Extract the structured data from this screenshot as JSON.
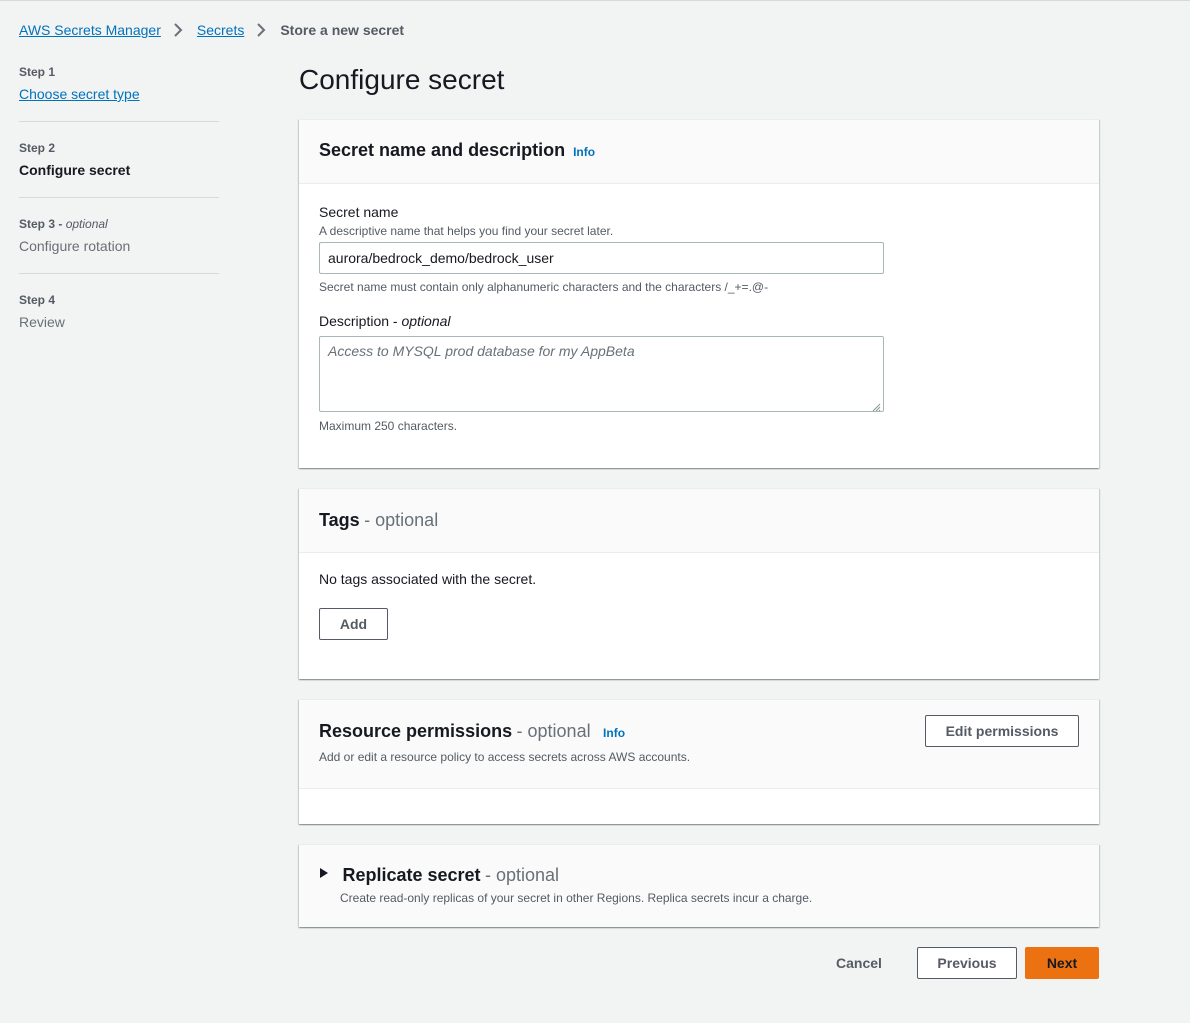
{
  "breadcrumb": {
    "items": [
      "AWS Secrets Manager",
      "Secrets"
    ],
    "current": "Store a new secret"
  },
  "steps": [
    {
      "label": "Step 1",
      "optional": "",
      "title": "Choose secret type",
      "state": "link"
    },
    {
      "label": "Step 2",
      "optional": "",
      "title": "Configure secret",
      "state": "current"
    },
    {
      "label": "Step 3 -",
      "optional": "optional",
      "title": "Configure rotation",
      "state": "disabled"
    },
    {
      "label": "Step 4",
      "optional": "",
      "title": "Review",
      "state": "disabled"
    }
  ],
  "page_title": "Configure secret",
  "name_panel": {
    "title": "Secret name and description",
    "info": "Info",
    "secret_name_label": "Secret name",
    "secret_name_desc": "A descriptive name that helps you find your secret later.",
    "secret_name_value": "aurora/bedrock_demo/bedrock_user",
    "secret_name_constraint": "Secret name must contain only alphanumeric characters and the characters /_+=.@-",
    "description_label": "Description -",
    "description_optional": "optional",
    "description_placeholder": "Access to MYSQL prod database for my AppBeta",
    "description_constraint": "Maximum 250 characters."
  },
  "tags_panel": {
    "title": "Tags",
    "optional": "- optional",
    "empty_text": "No tags associated with the secret.",
    "add_label": "Add"
  },
  "permissions_panel": {
    "title": "Resource permissions",
    "optional": "- optional",
    "info": "Info",
    "desc": "Add or edit a resource policy to access secrets across AWS accounts.",
    "edit_label": "Edit permissions"
  },
  "replicate_panel": {
    "title": "Replicate secret",
    "optional": "- optional",
    "desc": "Create read-only replicas of your secret in other Regions. Replica secrets incur a charge."
  },
  "footer": {
    "cancel": "Cancel",
    "previous": "Previous",
    "next": "Next"
  },
  "colors": {
    "link": "#0073bb",
    "primary": "#ec7211",
    "background": "#f2f3f3"
  }
}
